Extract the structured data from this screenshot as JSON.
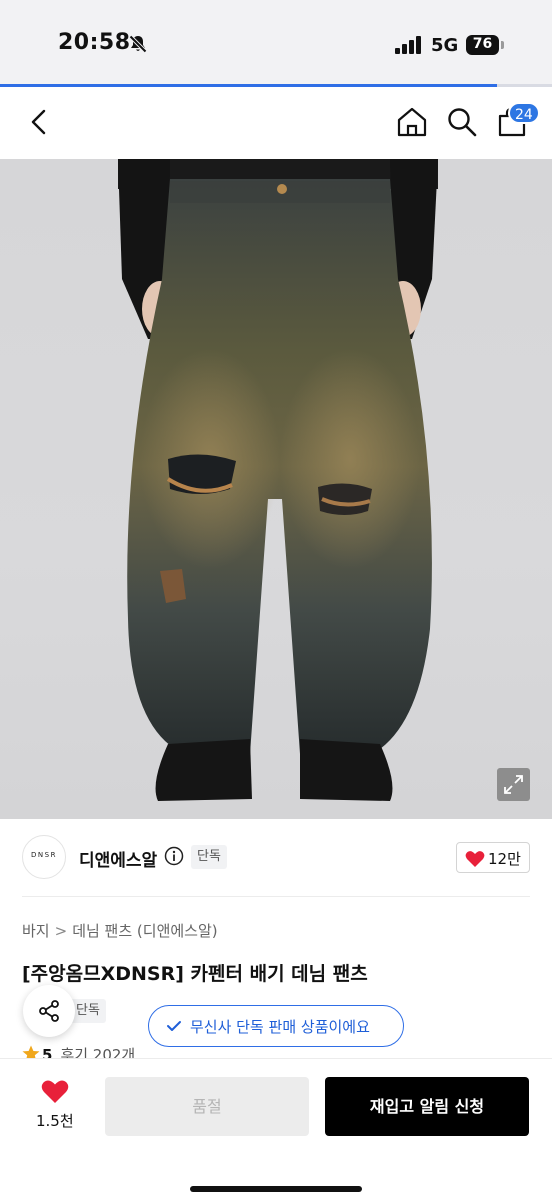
{
  "status_bar": {
    "time": "20:58",
    "network": "5G",
    "battery": "76"
  },
  "page_progress": 0.9,
  "nav": {
    "cart_count": "24"
  },
  "product_image": {
    "alt": ""
  },
  "brand": {
    "logo_text": "DNSR",
    "name": "디앤에스알",
    "exclusive_tag": "단독",
    "likes": "12만"
  },
  "breadcrumb": [
    "바지",
    "데님 팬츠 (디앤에스알)"
  ],
  "product": {
    "title": "[주앙옴므XDNSR] 카펜터 배기 데님 팬츠",
    "small_tag": "단독",
    "exclusive_banner": "무신사 단독 판매 상품이에요",
    "rating": "5",
    "reviews": "후기 202개"
  },
  "bottom_bar": {
    "wish_count": "1.5천",
    "soldout_label": "품절",
    "restock_label": "재입고 알림 신청"
  },
  "colors": {
    "accent": "#2f6ee6",
    "like_red": "#e8203a",
    "star": "#f0a71c"
  },
  "icons": [
    "bell-off-icon",
    "signal-icon",
    "battery-icon",
    "back-icon",
    "home-icon",
    "search-icon",
    "cart-icon",
    "expand-icon",
    "info-icon",
    "heart-icon",
    "share-icon",
    "check-icon",
    "star-icon"
  ]
}
